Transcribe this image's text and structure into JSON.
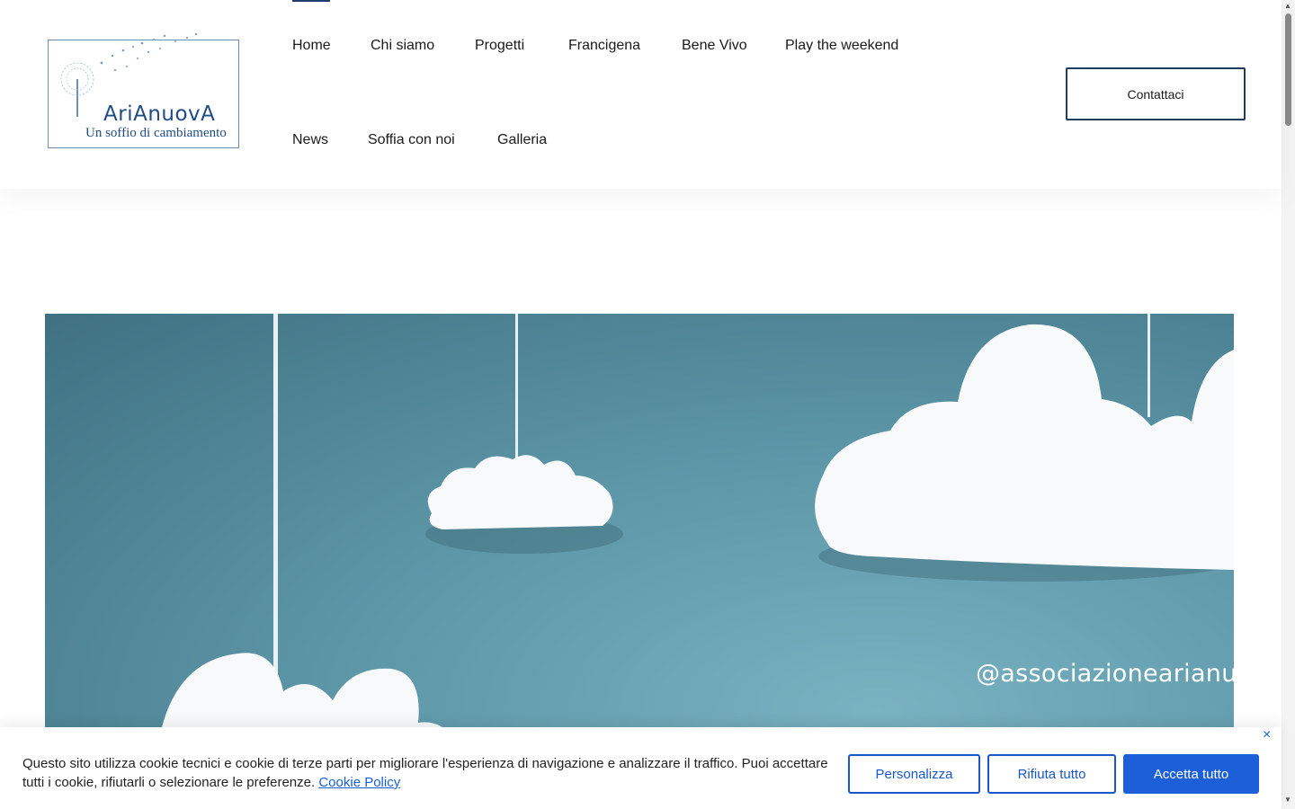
{
  "logo": {
    "title": "AriAnuovA",
    "subtitle": "Un soffio di cambiamento"
  },
  "nav": {
    "items": [
      {
        "label": "Home",
        "active": true
      },
      {
        "label": "Chi siamo"
      },
      {
        "label": "Progetti"
      },
      {
        "label": "Francigena"
      },
      {
        "label": "Bene Vivo"
      },
      {
        "label": "Play the weekend"
      },
      {
        "label": "News"
      },
      {
        "label": "Soffia con noi"
      },
      {
        "label": "Galleria"
      }
    ],
    "contact_label": "Contattaci"
  },
  "hero": {
    "handle": "@associazionearianu"
  },
  "cookie": {
    "text": "Questo sito utilizza cookie tecnici e cookie di terze parti per migliorare l'esperienza di navigazione e analizzare il traffico. Puoi accettare tutti i cookie, rifiutarli o selezionare le preferenze.",
    "link": "Cookie Policy",
    "close": "×",
    "customize_label": "Personalizza",
    "reject_label": "Rifiuta tutto",
    "accept_label": "Accetta tutto"
  },
  "colors": {
    "accent": "#1d5fd8",
    "brand_blue": "#1f4b86",
    "hero_teal": "#5d97a8"
  },
  "icons": {
    "close": "close-icon",
    "scroll_up": "scroll-up-icon",
    "scroll_down": "scroll-down-icon"
  }
}
